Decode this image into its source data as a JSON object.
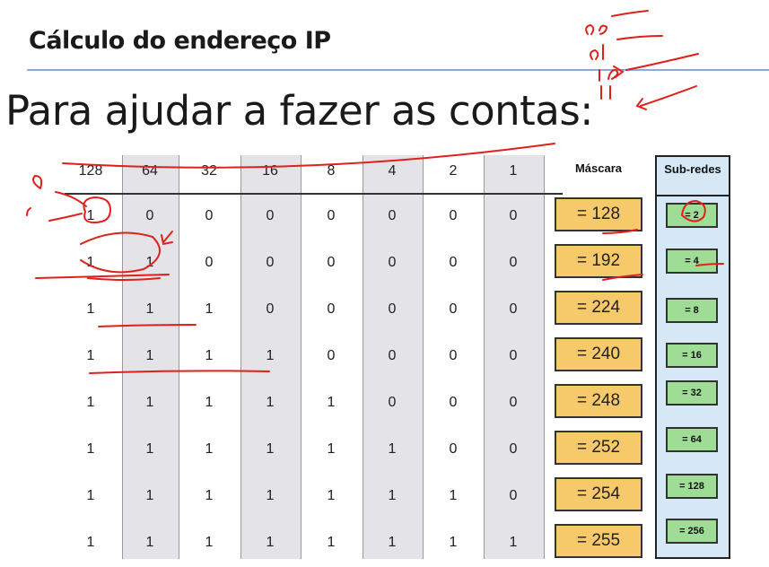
{
  "slide": {
    "title": "Cálculo do endereço IP",
    "subtitle": "Para ajudar a fazer as contas:"
  },
  "table": {
    "bit_headers": [
      "128",
      "64",
      "32",
      "16",
      "8",
      "4",
      "2",
      "1"
    ],
    "mask_header": "Máscara",
    "subnet_header": "Sub-redes",
    "rows": [
      {
        "bits": [
          "1",
          "0",
          "0",
          "0",
          "0",
          "0",
          "0",
          "0"
        ],
        "mask": "= 128",
        "subnets": "= 2"
      },
      {
        "bits": [
          "1",
          "1",
          "0",
          "0",
          "0",
          "0",
          "0",
          "0"
        ],
        "mask": "= 192",
        "subnets": "= 4"
      },
      {
        "bits": [
          "1",
          "1",
          "1",
          "0",
          "0",
          "0",
          "0",
          "0"
        ],
        "mask": "= 224",
        "subnets": "= 8"
      },
      {
        "bits": [
          "1",
          "1",
          "1",
          "1",
          "0",
          "0",
          "0",
          "0"
        ],
        "mask": "= 240",
        "subnets": "= 16"
      },
      {
        "bits": [
          "1",
          "1",
          "1",
          "1",
          "1",
          "0",
          "0",
          "0"
        ],
        "mask": "= 248",
        "subnets": "= 32"
      },
      {
        "bits": [
          "1",
          "1",
          "1",
          "1",
          "1",
          "1",
          "0",
          "0"
        ],
        "mask": "= 252",
        "subnets": "= 64"
      },
      {
        "bits": [
          "1",
          "1",
          "1",
          "1",
          "1",
          "1",
          "1",
          "0"
        ],
        "mask": "= 254",
        "subnets": "= 128"
      },
      {
        "bits": [
          "1",
          "1",
          "1",
          "1",
          "1",
          "1",
          "1",
          "1"
        ],
        "mask": "= 255",
        "subnets": "= 256"
      }
    ]
  },
  "annotations": {
    "ink_color": "#e0201a",
    "handwritten_marks": [
      "0",
      "1",
      "00",
      "01",
      "10",
      "11"
    ]
  }
}
